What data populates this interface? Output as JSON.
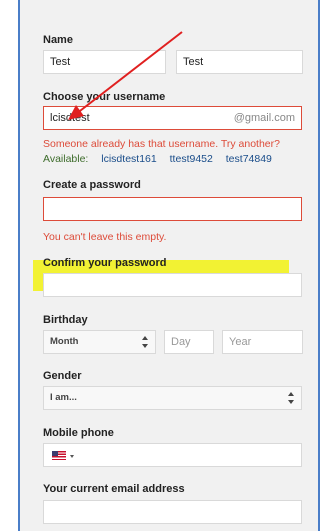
{
  "name": {
    "label": "Name",
    "first_value": "Test",
    "last_value": "Test"
  },
  "username": {
    "label": "Choose your username",
    "value": "lcisdtest",
    "suffix": "@gmail.com",
    "error": "Someone already has that username. Try another?",
    "available_label": "Available:",
    "suggestions": [
      "lcisdtest161",
      "ttest9452",
      "test74849"
    ]
  },
  "password": {
    "label": "Create a password",
    "value": "",
    "error": "You can't leave this empty."
  },
  "confirm": {
    "label": "Confirm your password",
    "value": ""
  },
  "birthday": {
    "label": "Birthday",
    "month": "Month",
    "day_placeholder": "Day",
    "year_placeholder": "Year"
  },
  "gender": {
    "label": "Gender",
    "value": "I am..."
  },
  "mobile": {
    "label": "Mobile phone",
    "value": ""
  },
  "current_email": {
    "label": "Your current email address",
    "value": ""
  },
  "colors": {
    "error": "#dd4b39",
    "highlight": "#f2f233",
    "arrow": "#e02020",
    "frame": "#4a7ec8"
  },
  "icons": {
    "flag": "us-flag-icon",
    "arrow": "red-arrow-annotation"
  }
}
